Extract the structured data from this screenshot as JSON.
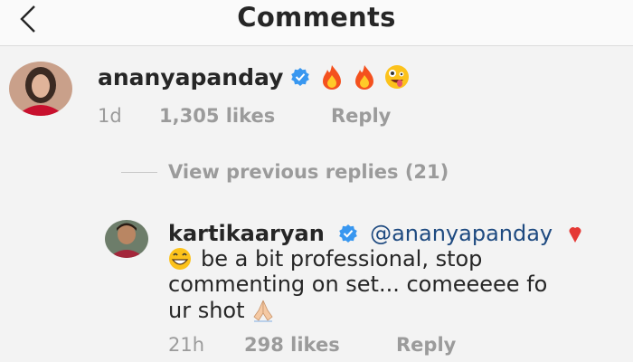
{
  "header": {
    "title": "Comments",
    "back_icon": "chevron-left-icon"
  },
  "comment": {
    "username": "ananyapanday",
    "verified_icon": "verified-badge-icon",
    "emojis": [
      "fire-icon",
      "fire-icon",
      "zany-face-icon"
    ],
    "time": "1d",
    "likes": "1,305 likes",
    "reply": "Reply"
  },
  "view_previous": "View previous replies (21)",
  "reply_comment": {
    "username": "kartikaaryan",
    "verified_icon": "verified-badge-icon",
    "mention": "@ananyapanday",
    "text_line1": "be a bit professional, stop",
    "text_line2": "commenting on set... comeeeee fo",
    "text_line3": "ur shot",
    "emojis": [
      "heart-icon",
      "grinning-face-icon",
      "folded-hands-icon"
    ],
    "time": "21h",
    "likes": "298 likes",
    "reply": "Reply"
  },
  "colors": {
    "verified": "#3897f0",
    "mention": "#1e4a80",
    "meta": "#9b9b9b",
    "text": "#262626"
  }
}
